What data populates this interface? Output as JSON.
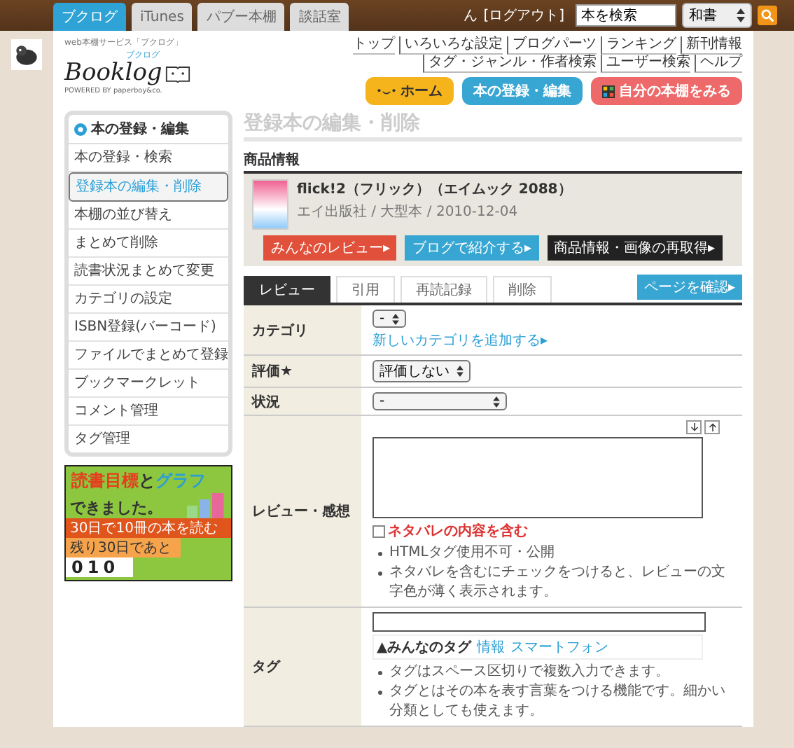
{
  "top_bar": {
    "tabs": [
      {
        "label": "ブクログ",
        "selected": true
      },
      {
        "label": "iTunes",
        "selected": false
      },
      {
        "label": "パブー本棚",
        "selected": false
      },
      {
        "label": "談話室",
        "selected": false
      }
    ],
    "user": "ん",
    "logout": "[ログアウト]",
    "search": {
      "value": "本を検索"
    },
    "search_scope": "和書"
  },
  "logo": {
    "tagline": "web本棚サービス「ブクログ」",
    "name": "Booklog",
    "ruby": "ブクログ",
    "powered": "POWERED BY",
    "company": "paperboy&co."
  },
  "nav": {
    "links": [
      "トップ",
      "いろいろな設定",
      "ブログパーツ",
      "ランキング",
      "新刊情報",
      "タグ・ジャンル・作者検索",
      "ユーザー検索",
      "ヘルプ"
    ]
  },
  "header_buttons": [
    {
      "label": "ホーム",
      "kind": "home"
    },
    {
      "label": "本の登録・編集",
      "kind": "register"
    },
    {
      "label": "自分の本棚をみる",
      "kind": "shelf"
    }
  ],
  "sidebar": {
    "heading": "本の登録・編集",
    "items": [
      {
        "label": "本の登録・検索",
        "selected": false
      },
      {
        "label": "登録本の編集・削除",
        "selected": true
      },
      {
        "label": "本棚の並び替え",
        "selected": false
      },
      {
        "label": "まとめて削除",
        "selected": false
      },
      {
        "label": "読書状況まとめて変更",
        "selected": false
      },
      {
        "label": "カテゴリの設定",
        "selected": false
      },
      {
        "label": "ISBN登録(バーコード)",
        "selected": false
      },
      {
        "label": "ファイルでまとめて登録",
        "selected": false
      },
      {
        "label": "ブックマークレット",
        "selected": false
      },
      {
        "label": "コメント管理",
        "selected": false
      },
      {
        "label": "タグ管理",
        "selected": false
      }
    ]
  },
  "banner": {
    "title_1": "読書目標",
    "title_2": "と",
    "title_3": "グラフ",
    "title_4": "できました。",
    "goal": "30日で10冊の本を読む",
    "remaining": "残り30日であと",
    "counter": "010"
  },
  "page_title": "登録本の編集・削除",
  "product": {
    "heading": "商品情報",
    "title": "flick!2（フリック）（エイムック 2088）",
    "meta": "エイ出版社 / 大型本 / 2010-12-04",
    "buttons": [
      {
        "label": "みんなのレビュー▸",
        "kind": "reviews"
      },
      {
        "label": "ブログで紹介する▸",
        "kind": "blog"
      },
      {
        "label": "商品情報・画像の再取得▸",
        "kind": "refresh"
      }
    ]
  },
  "tabs": [
    {
      "label": "レビュー",
      "selected": true
    },
    {
      "label": "引用",
      "selected": false
    },
    {
      "label": "再読記録",
      "selected": false
    },
    {
      "label": "削除",
      "selected": false
    }
  ],
  "confirm_button": "ページを確認▸",
  "form": {
    "rows": [
      {
        "kind": "category",
        "label": "カテゴリ",
        "select": "-",
        "link": "新しいカテゴリを追加する▸"
      },
      {
        "kind": "select",
        "label": "評価★",
        "select": "評価しない"
      },
      {
        "kind": "select",
        "label": "状況",
        "select": "-"
      },
      {
        "kind": "review",
        "label": "レビュー・感想",
        "spoiler": {
          "label": "ネタバレの内容を含む",
          "checked": false
        },
        "notes": [
          "HTMLタグ使用不可・公開",
          "ネタバレを含むにチェックをつけると、レビューの文字色が薄く表示されます。"
        ]
      },
      {
        "kind": "tag",
        "label": "タグ",
        "everyone_tags_label": "▲みんなのタグ",
        "tags": [
          "情報",
          "スマートフォン"
        ],
        "notes": [
          "タグはスペース区切りで複数入力できます。",
          "タグとはその本を表す言葉をつける機能です。細かい分類としても使えます。"
        ]
      }
    ]
  }
}
